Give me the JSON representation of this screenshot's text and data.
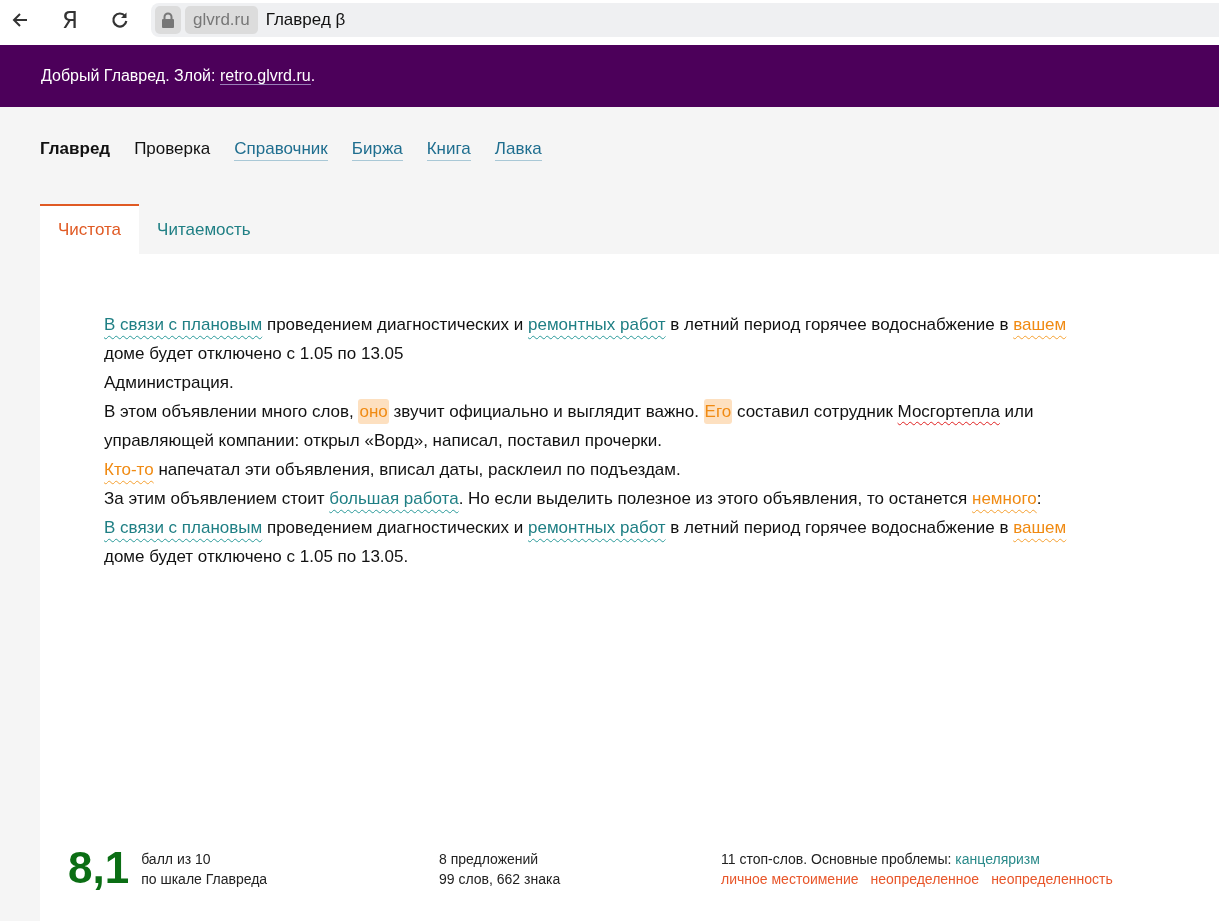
{
  "browser": {
    "domain": "glvrd.ru",
    "title": "Главред β",
    "logo_letter": "Я"
  },
  "banner": {
    "text": "Добрый Главред. Злой: ",
    "link": "retro.glvrd.ru",
    "end": "."
  },
  "nav": [
    {
      "label": "Главред",
      "kind": "current"
    },
    {
      "label": "Проверка",
      "kind": "plain"
    },
    {
      "label": "Справочник",
      "kind": "link"
    },
    {
      "label": "Биржа",
      "kind": "link"
    },
    {
      "label": "Книга",
      "kind": "link"
    },
    {
      "label": "Лавка",
      "kind": "link"
    }
  ],
  "tabs": [
    {
      "label": "Чистота",
      "selected": true
    },
    {
      "label": "Читаемость",
      "selected": false
    }
  ],
  "text_lines": [
    [
      {
        "t": "В связи с плановым",
        "kind": "teal"
      },
      {
        "t": " проведением диагностических и ",
        "kind": "plain"
      },
      {
        "t": "ремонтных работ",
        "kind": "teal"
      },
      {
        "t": " в летний период горячее водоснабжение в ",
        "kind": "plain"
      },
      {
        "t": "вашем",
        "kind": "orange"
      }
    ],
    [
      {
        "t": "доме будет отключено с 1.05 по 13.05",
        "kind": "plain"
      }
    ],
    [
      {
        "t": "Администрация.",
        "kind": "plain"
      }
    ],
    [
      {
        "t": "В этом объявлении много слов, ",
        "kind": "plain"
      },
      {
        "t": "оно",
        "kind": "marked"
      },
      {
        "t": " звучит официально и выглядит важно. ",
        "kind": "plain"
      },
      {
        "t": "Его",
        "kind": "marked"
      },
      {
        "t": " составил сотрудник ",
        "kind": "plain"
      },
      {
        "t": "Мосгортепла",
        "kind": "spelling"
      },
      {
        "t": " или",
        "kind": "plain"
      }
    ],
    [
      {
        "t": "управляющей компании: открыл «Ворд», написал, поставил прочерки.",
        "kind": "plain"
      }
    ],
    [
      {
        "t": "Кто-то",
        "kind": "orange"
      },
      {
        "t": " напечатал эти объявления, вписал даты, расклеил по подъездам.",
        "kind": "plain"
      }
    ],
    [
      {
        "t": "За этим объявлением стоит ",
        "kind": "plain"
      },
      {
        "t": "большая работа",
        "kind": "teal"
      },
      {
        "t": ". Но если выделить полезное из этого объявления, то останется ",
        "kind": "plain"
      },
      {
        "t": "немного",
        "kind": "orange"
      },
      {
        "t": ":",
        "kind": "plain"
      }
    ],
    [
      {
        "t": "В связи с плановым",
        "kind": "teal"
      },
      {
        "t": " проведением диагностических и ",
        "kind": "plain"
      },
      {
        "t": "ремонтных работ",
        "kind": "teal"
      },
      {
        "t": " в летний период горячее водоснабжение в ",
        "kind": "plain"
      },
      {
        "t": "вашем",
        "kind": "orange"
      }
    ],
    [
      {
        "t": "доме будет отключено с 1.05 по 13.05.",
        "kind": "plain"
      }
    ]
  ],
  "stats": {
    "score": "8,1",
    "score_caption": [
      "балл из 10",
      "по шкале Главреда"
    ],
    "counts": [
      "8 предложений",
      "99 слов, 662 знака"
    ],
    "stopwords": "11 стоп-слов. Основные проблемы: ",
    "problems": [
      {
        "label": "канцеляризм",
        "color": "#2a8a8a"
      },
      {
        "label": "личное местоимение",
        "color": "#e8562a"
      },
      {
        "label": "неопределенное",
        "color": "#e8562a"
      },
      {
        "label": "неопределенность",
        "color": "#e8562a"
      }
    ]
  }
}
